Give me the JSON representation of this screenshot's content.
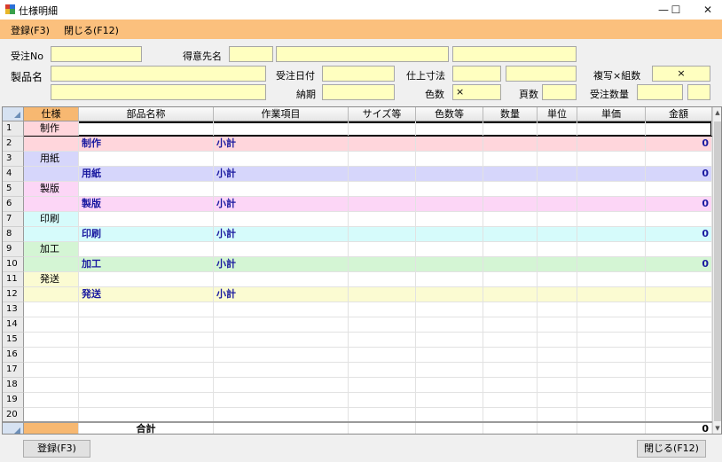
{
  "window": {
    "title": "仕様明細",
    "min": "—",
    "max": "☐",
    "close": "✕"
  },
  "menu": {
    "register": "登録(F3)",
    "close": "閉じる(F12)"
  },
  "form": {
    "order_no_label": "受注No",
    "order_no": "",
    "customer_label": "得意先名",
    "customer_code": "",
    "customer_name": "",
    "customer_extra": "",
    "product_label": "製品名",
    "product_name": "",
    "product_name2": "",
    "order_date_label": "受注日付",
    "order_date": "",
    "delivery_label": "納期",
    "delivery": "",
    "finish_size_label": "仕上寸法",
    "finish_w": "",
    "finish_h": "",
    "colors_label": "色数",
    "colors": "×",
    "pages_label": "頁数",
    "pages": "",
    "copies_label": "複写×組数",
    "copies": "×",
    "qty_label": "受注数量",
    "qty": "",
    "qty_unit": ""
  },
  "grid": {
    "columns": [
      "仕様",
      "部品名称",
      "作業項目",
      "サイズ等",
      "色数等",
      "数量",
      "単位",
      "単価",
      "金額"
    ],
    "rows": [
      {
        "no": "1",
        "spec": "制作",
        "part": "",
        "work": "",
        "amount": ""
      },
      {
        "no": "2",
        "spec": "",
        "part": "制作",
        "work": "小計",
        "amount": "0"
      },
      {
        "no": "3",
        "spec": "用紙",
        "part": "",
        "work": "",
        "amount": ""
      },
      {
        "no": "4",
        "spec": "",
        "part": "用紙",
        "work": "小計",
        "amount": "0"
      },
      {
        "no": "5",
        "spec": "製版",
        "part": "",
        "work": "",
        "amount": ""
      },
      {
        "no": "6",
        "spec": "",
        "part": "製版",
        "work": "小計",
        "amount": "0"
      },
      {
        "no": "7",
        "spec": "印刷",
        "part": "",
        "work": "",
        "amount": ""
      },
      {
        "no": "8",
        "spec": "",
        "part": "印刷",
        "work": "小計",
        "amount": "0"
      },
      {
        "no": "9",
        "spec": "加工",
        "part": "",
        "work": "",
        "amount": ""
      },
      {
        "no": "10",
        "spec": "",
        "part": "加工",
        "work": "小計",
        "amount": "0"
      },
      {
        "no": "11",
        "spec": "発送",
        "part": "",
        "work": "",
        "amount": ""
      },
      {
        "no": "12",
        "spec": "",
        "part": "発送",
        "work": "小計",
        "amount": ""
      },
      {
        "no": "13",
        "spec": "",
        "part": "",
        "work": "",
        "amount": ""
      },
      {
        "no": "14",
        "spec": "",
        "part": "",
        "work": "",
        "amount": ""
      },
      {
        "no": "15",
        "spec": "",
        "part": "",
        "work": "",
        "amount": ""
      },
      {
        "no": "16",
        "spec": "",
        "part": "",
        "work": "",
        "amount": ""
      },
      {
        "no": "17",
        "spec": "",
        "part": "",
        "work": "",
        "amount": ""
      },
      {
        "no": "18",
        "spec": "",
        "part": "",
        "work": "",
        "amount": ""
      },
      {
        "no": "19",
        "spec": "",
        "part": "",
        "work": "",
        "amount": ""
      },
      {
        "no": "20",
        "spec": "",
        "part": "",
        "work": "",
        "amount": ""
      }
    ],
    "total_label": "合計",
    "total_amount": "0"
  },
  "colors": {
    "制作": "#ffd6dc",
    "用紙": "#d6d6fb",
    "製版": "#fcd6f6",
    "印刷": "#d6fbfb",
    "加工": "#d4f5d4",
    "発送": "#fbfbd2"
  },
  "footer": {
    "register": "登録(F3)",
    "close": "閉じる(F12)"
  }
}
